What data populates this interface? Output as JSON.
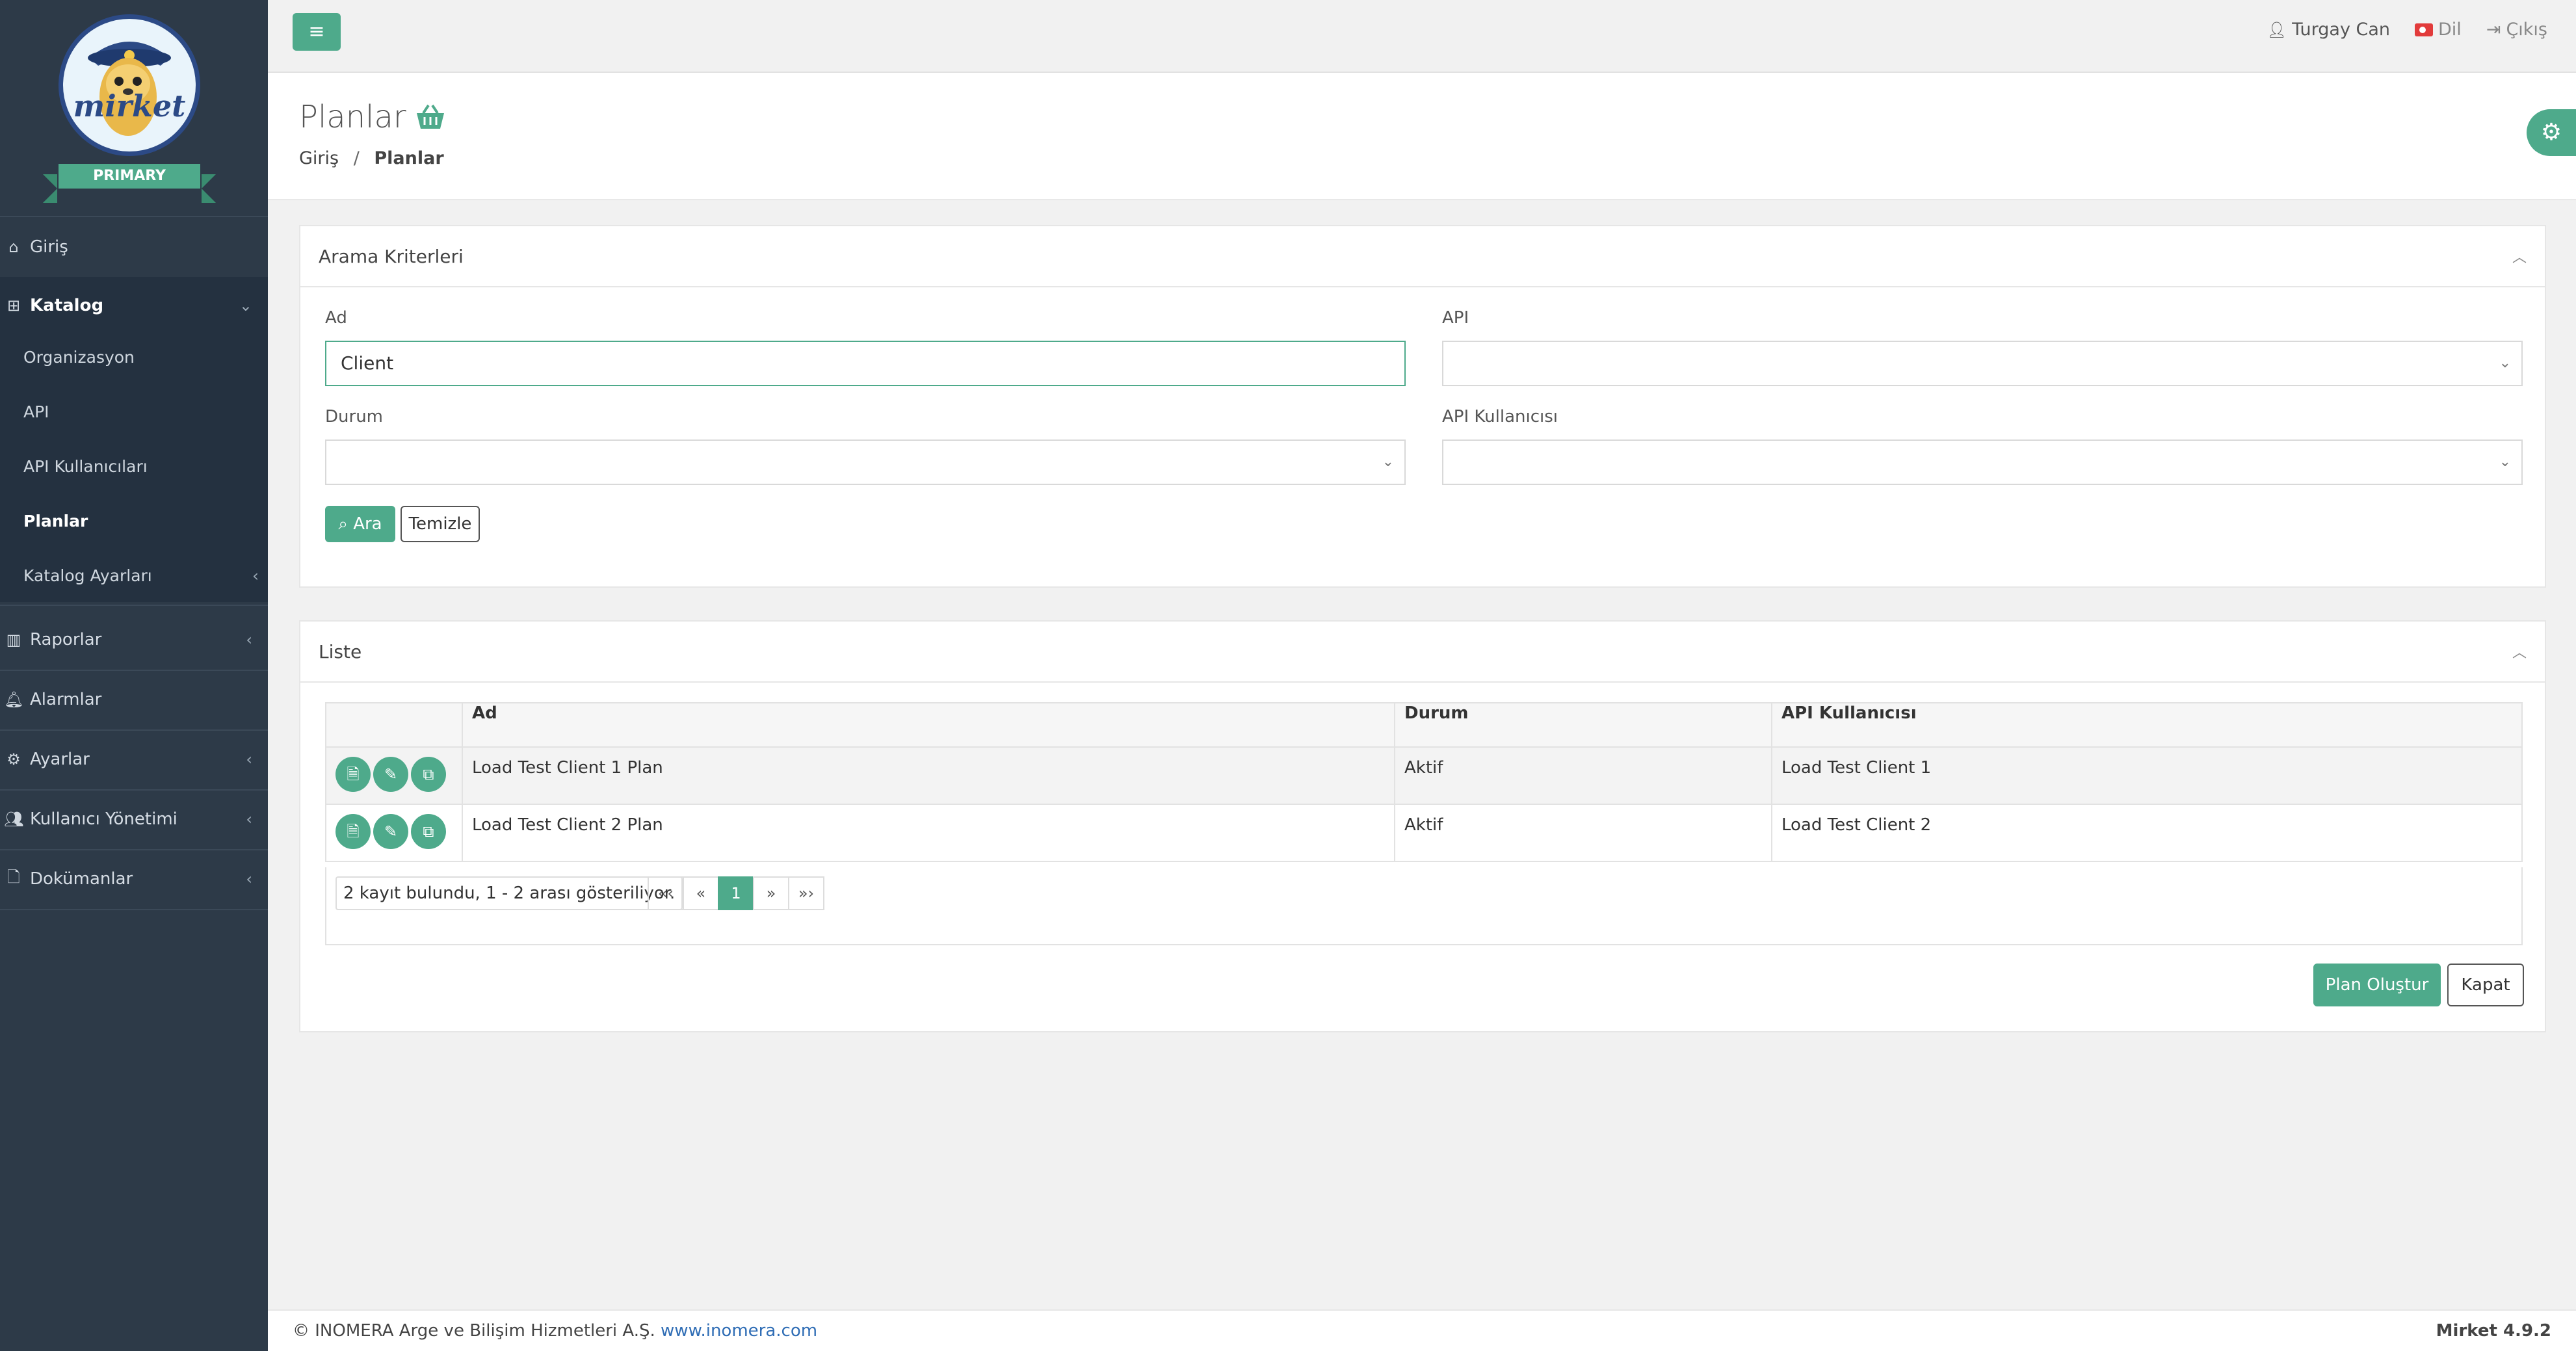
{
  "brand": {
    "logo_text": "mirket",
    "badge": "PRIMARY"
  },
  "sidebar": {
    "items": [
      {
        "label": "Giriş",
        "icon": "home-icon"
      },
      {
        "label": "Katalog",
        "icon": "sitemap-icon",
        "expanded": true
      },
      {
        "label": "Raporlar",
        "icon": "chart-icon"
      },
      {
        "label": "Alarmlar",
        "icon": "bell-icon"
      },
      {
        "label": "Ayarlar",
        "icon": "gears-icon"
      },
      {
        "label": "Kullanıcı Yönetimi",
        "icon": "users-icon"
      },
      {
        "label": "Dokümanlar",
        "icon": "file-icon"
      }
    ],
    "catalog_sub": [
      {
        "label": "Organizasyon"
      },
      {
        "label": "API"
      },
      {
        "label": "API Kullanıcıları"
      },
      {
        "label": "Planlar",
        "current": true
      },
      {
        "label": "Katalog Ayarları"
      }
    ]
  },
  "topbar": {
    "user": "Turgay Can",
    "language": "Dil",
    "logout": "Çıkış"
  },
  "page": {
    "title": "Planlar",
    "breadcrumb": [
      "Giriş",
      "Planlar"
    ]
  },
  "search": {
    "title": "Arama Kriterleri",
    "fields": {
      "ad_label": "Ad",
      "ad_value": "Client",
      "api_label": "API",
      "api_value": "",
      "durum_label": "Durum",
      "durum_value": "",
      "api_user_label": "API Kullanıcısı",
      "api_user_value": ""
    },
    "search_button": "Ara",
    "clear_button": "Temizle"
  },
  "list": {
    "title": "Liste",
    "columns": [
      "Ad",
      "Durum",
      "API Kullanıcısı"
    ],
    "rows": [
      {
        "ad": "Load Test Client 1 Plan",
        "durum": "Aktif",
        "api_user": "Load Test Client 1"
      },
      {
        "ad": "Load Test Client 2 Plan",
        "durum": "Aktif",
        "api_user": "Load Test Client 2"
      }
    ],
    "record_info": "2 kayıt bulundu, 1 - 2 arası gösteriliyor.",
    "pager": {
      "first": "«‹",
      "prev": "«",
      "current": "1",
      "next": "»",
      "last": "»›"
    },
    "create_button": "Plan Oluştur",
    "close_button": "Kapat"
  },
  "footer": {
    "copyright": "© INOMERA Arge ve Bilişim Hizmetleri A.Ş.",
    "link": "www.inomera.com",
    "version": "Mirket 4.9.2"
  },
  "colors": {
    "accent": "#4eaa8b",
    "sidebar": "#2d3a48"
  }
}
